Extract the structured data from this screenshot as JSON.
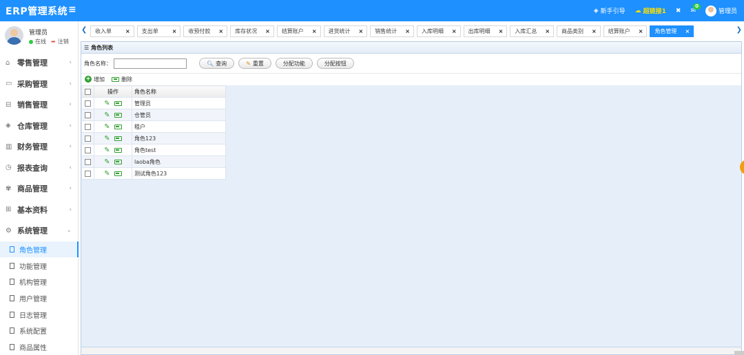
{
  "app": {
    "title": "ERP管理系统",
    "menu_toggle": "≡"
  },
  "topbar": {
    "guide_label": "新手引导",
    "super_link_label": "超链接1",
    "mail_badge": "0",
    "admin_label": "管理员"
  },
  "user": {
    "name": "管理员",
    "status": "在线",
    "logout": "注销"
  },
  "sidebar": {
    "menus": [
      {
        "icon": "⌂",
        "label": "零售管理",
        "chevron": "‹"
      },
      {
        "icon": "▭",
        "label": "采购管理",
        "chevron": "‹"
      },
      {
        "icon": "⊟",
        "label": "销售管理",
        "chevron": "‹"
      },
      {
        "icon": "◈",
        "label": "仓库管理",
        "chevron": "‹"
      },
      {
        "icon": "▥",
        "label": "财务管理",
        "chevron": "‹"
      },
      {
        "icon": "◷",
        "label": "报表查询",
        "chevron": "‹"
      },
      {
        "icon": "✾",
        "label": "商品管理",
        "chevron": "‹"
      },
      {
        "icon": "⊞",
        "label": "基本资料",
        "chevron": "‹"
      },
      {
        "icon": "⚙",
        "label": "系统管理",
        "chevron": "⌄"
      }
    ],
    "sub_items": [
      {
        "label": "角色管理"
      },
      {
        "label": "功能管理"
      },
      {
        "label": "机构管理"
      },
      {
        "label": "用户管理"
      },
      {
        "label": "日志管理"
      },
      {
        "label": "系统配置"
      },
      {
        "label": "商品属性"
      }
    ]
  },
  "tabs": [
    {
      "label": "收入单"
    },
    {
      "label": "支出单"
    },
    {
      "label": "收预付款"
    },
    {
      "label": "库存状况"
    },
    {
      "label": "结算账户"
    },
    {
      "label": "进货统计"
    },
    {
      "label": "销售统计"
    },
    {
      "label": "入库明细"
    },
    {
      "label": "出库明细"
    },
    {
      "label": "入库汇总"
    },
    {
      "label": "商品类别"
    },
    {
      "label": "结算账户"
    },
    {
      "label": "角色管理"
    }
  ],
  "tab_close": "×",
  "panel": {
    "title": "角色列表",
    "search_label": "角色名称：",
    "search_value": "",
    "buttons": {
      "query": "查询",
      "reset": "重置",
      "assign_func": "分配功能",
      "assign_btn": "分配按钮"
    },
    "toolbar": {
      "add": "增加",
      "delete": "删除"
    },
    "columns": {
      "op": "操作",
      "name": "角色名称"
    },
    "rows": [
      {
        "name": "管理员"
      },
      {
        "name": "仓管员"
      },
      {
        "name": "租户"
      },
      {
        "name": "角色123"
      },
      {
        "name": "角色test"
      },
      {
        "name": "laoba角色"
      },
      {
        "name": "测试角色123"
      }
    ]
  }
}
